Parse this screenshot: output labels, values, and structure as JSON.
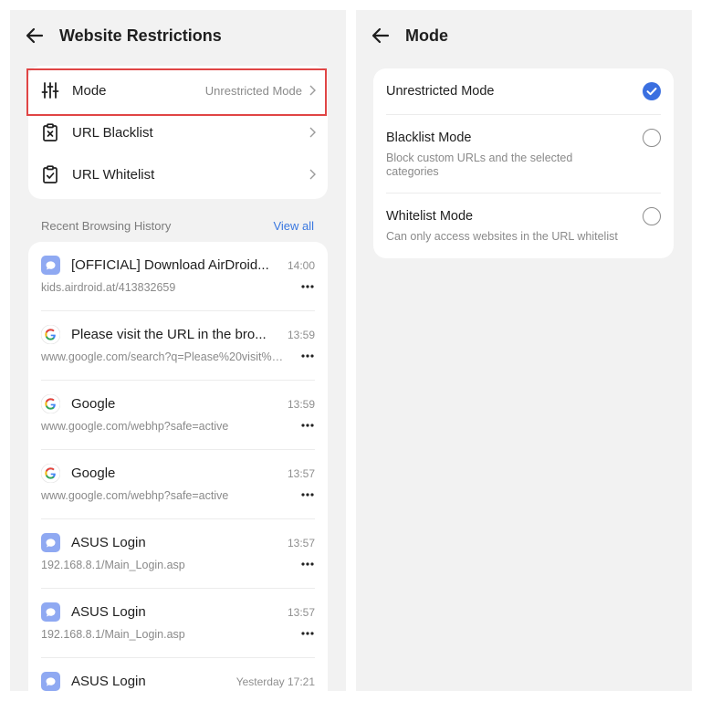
{
  "left_panel": {
    "title": "Website Restrictions",
    "settings": [
      {
        "label": "Mode",
        "value": "Unrestricted Mode",
        "icon": "sliders-icon"
      },
      {
        "label": "URL Blacklist",
        "value": "",
        "icon": "clipboard-x-icon"
      },
      {
        "label": "URL Whitelist",
        "value": "",
        "icon": "clipboard-check-icon"
      }
    ],
    "history_heading": "Recent Browsing History",
    "view_all": "View all",
    "history": [
      {
        "title": "[OFFICIAL] Download AirDroid...",
        "url": "kids.airdroid.at/413832659",
        "time": "14:00",
        "icon": "airdroid-icon"
      },
      {
        "title": "Please visit the URL in the bro...",
        "url": "www.google.com/search?q=Please%20visit%2...",
        "time": "13:59",
        "icon": "google-icon"
      },
      {
        "title": "Google",
        "url": "www.google.com/webhp?safe=active",
        "time": "13:59",
        "icon": "google-icon"
      },
      {
        "title": "Google",
        "url": "www.google.com/webhp?safe=active",
        "time": "13:57",
        "icon": "google-icon"
      },
      {
        "title": "ASUS Login",
        "url": "192.168.8.1/Main_Login.asp",
        "time": "13:57",
        "icon": "airdroid-icon"
      },
      {
        "title": "ASUS Login",
        "url": "192.168.8.1/Main_Login.asp",
        "time": "13:57",
        "icon": "airdroid-icon"
      },
      {
        "title": "ASUS Login",
        "url": "",
        "time": "Yesterday 17:21",
        "icon": "airdroid-icon"
      }
    ]
  },
  "right_panel": {
    "title": "Mode",
    "modes": [
      {
        "title": "Unrestricted Mode",
        "description": "",
        "selected": true
      },
      {
        "title": "Blacklist Mode",
        "description": "Block custom URLs and the selected categories",
        "selected": false
      },
      {
        "title": "Whitelist Mode",
        "description": "Can only access websites in the URL whitelist",
        "selected": false
      }
    ]
  },
  "colors": {
    "accent": "#3a6fe0",
    "highlight_border": "#e04545",
    "panel_bg": "#f2f2f2"
  }
}
